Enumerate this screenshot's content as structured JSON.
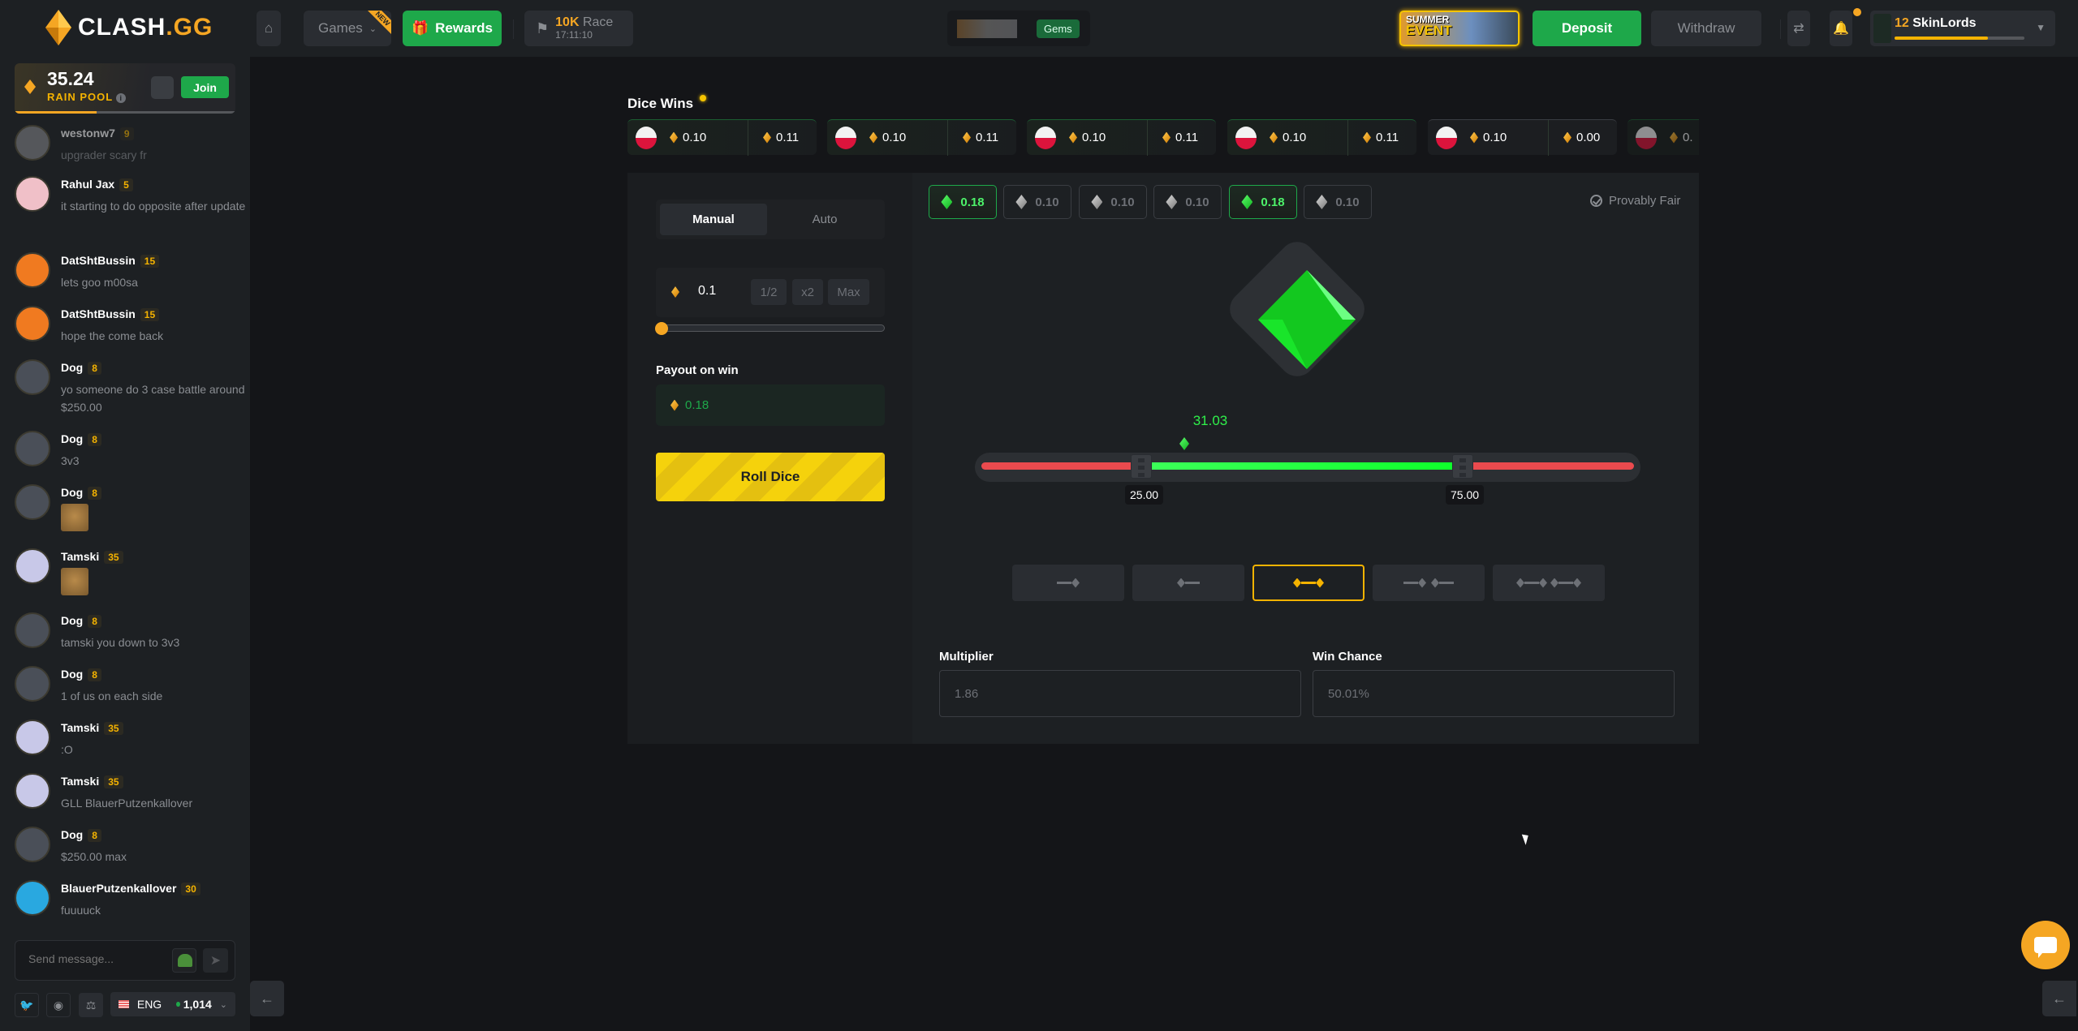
{
  "topbar": {
    "logo_main": "CLASH",
    "logo_suffix": ".GG",
    "games_label": "Games",
    "games_badge": "NEW",
    "rewards_label": "Rewards",
    "race_amount": "10K",
    "race_label": "Race",
    "race_timer": "17:11:10",
    "gems_label": "Gems",
    "event_line1": "SUMMER",
    "event_line2": "EVENT",
    "deposit_label": "Deposit",
    "withdraw_label": "Withdraw",
    "user_level": "12",
    "username": "SkinLords",
    "xp_progress_percent": 72
  },
  "rain": {
    "amount": "35.24",
    "label": "RAIN POOL",
    "join_label": "Join",
    "progress_percent": 37
  },
  "chat": {
    "messages": [
      {
        "user": "westonw7",
        "level": "9",
        "text": "upgrader scary fr"
      },
      {
        "user": "Rahul Jax",
        "level": "5",
        "text": "it starting to do opposite after update"
      },
      {
        "user": "DatShtBussin",
        "level": "15",
        "text": "lets goo m00sa"
      },
      {
        "user": "DatShtBussin",
        "level": "15",
        "text": "hope the come back"
      },
      {
        "user": "Dog",
        "level": "8",
        "text": "yo someone do 3 case battle around $250.00"
      },
      {
        "user": "Dog",
        "level": "8",
        "text": "3v3"
      },
      {
        "user": "Dog",
        "level": "8",
        "text": "[emote]"
      },
      {
        "user": "Tamski",
        "level": "35",
        "text": "[emote]"
      },
      {
        "user": "Dog",
        "level": "8",
        "text": "tamski you down to 3v3"
      },
      {
        "user": "Dog",
        "level": "8",
        "text": "1 of us on each side"
      },
      {
        "user": "Tamski",
        "level": "35",
        "text": ":O"
      },
      {
        "user": "Tamski",
        "level": "35",
        "text": "GLL BlauerPutzenkallover"
      },
      {
        "user": "Dog",
        "level": "8",
        "text": "$250.00 max"
      },
      {
        "user": "BlauerPutzenkallover",
        "level": "30",
        "text": "fuuuuck"
      }
    ],
    "input_placeholder": "Send message...",
    "language": "ENG",
    "online_count": "1,014"
  },
  "dice_wins": {
    "title": "Dice Wins",
    "items": [
      {
        "bet": "0.10",
        "payout": "0.11"
      },
      {
        "bet": "0.10",
        "payout": "0.11"
      },
      {
        "bet": "0.10",
        "payout": "0.11"
      },
      {
        "bet": "0.10",
        "payout": "0.11"
      },
      {
        "bet": "0.10",
        "payout": "0.00"
      },
      {
        "bet": "0.",
        "payout": ""
      }
    ]
  },
  "controls": {
    "tab_manual": "Manual",
    "tab_auto": "Auto",
    "bet_value": "0.1",
    "half_label": "1/2",
    "double_label": "x2",
    "max_label": "Max",
    "bet_slider_percent": 0,
    "payout_label": "Payout on win",
    "payout_value": "0.18",
    "roll_label": "Roll Dice"
  },
  "game": {
    "history": [
      {
        "value": "0.18",
        "win": true
      },
      {
        "value": "0.10",
        "win": false
      },
      {
        "value": "0.10",
        "win": false
      },
      {
        "value": "0.10",
        "win": false
      },
      {
        "value": "0.18",
        "win": true
      },
      {
        "value": "0.10",
        "win": false
      }
    ],
    "provably_fair": "Provably Fair",
    "roll_result": "31.03",
    "range_low": "25.00",
    "range_high": "75.00",
    "selected_mode": "between",
    "multiplier_label": "Multiplier",
    "multiplier_value": "1.86",
    "win_chance_label": "Win Chance",
    "win_chance_value": "50.01%",
    "colors": {
      "win": "#1ea84a",
      "loss": "#ea4a4e",
      "accent": "#f5a623"
    }
  }
}
